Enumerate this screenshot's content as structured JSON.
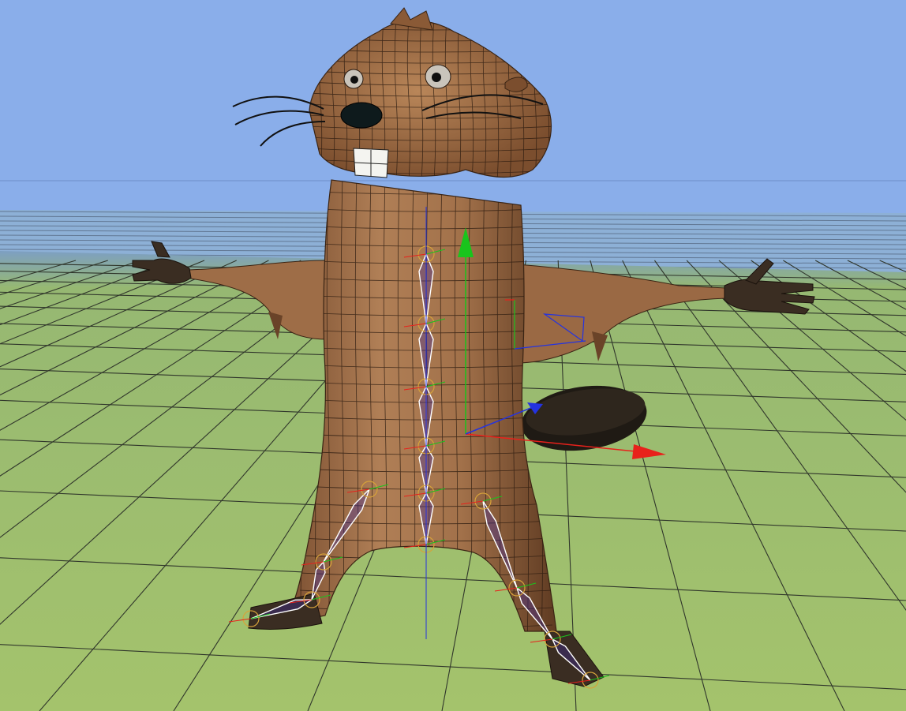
{
  "viewport": {
    "kind": "3d-perspective-viewport",
    "view": "perspective",
    "shading": "smooth-shaded-with-wireframe-on-shaded",
    "grid_visible": true
  },
  "scene": {
    "model": "cartoon-beaver-character",
    "skeleton": {
      "spine_joints": 6,
      "leg_chains": 2,
      "visible": true
    },
    "gizmo": {
      "type": "translate-manipulator",
      "axes": [
        "x",
        "y",
        "z"
      ]
    }
  },
  "colors": {
    "sky": "#8aaeea",
    "horizon_sky": "#7fa3e6",
    "ground": "#9ec06a",
    "ground_far": "#8eb4d8",
    "grid_line": "#2b2f2a",
    "fur": "#9a6a45",
    "fur_dark": "#6e4527",
    "fur_light": "#c08a5d",
    "wire": "#2a1a0f",
    "tail": "#2a2119",
    "hand": "#3c2e22",
    "teeth": "#f4f4f0",
    "nose": "#0e1a1c",
    "bone": "#ffffff",
    "axis_x": "#e8211b",
    "axis_y": "#19c41c",
    "axis_z": "#2433e0",
    "joint": "#d6a23a"
  },
  "icons": [
    "translate-gizmo",
    "joint-marker",
    "bone"
  ]
}
